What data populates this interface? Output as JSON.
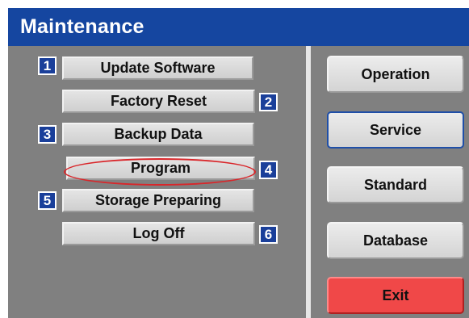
{
  "window": {
    "title": "Maintenance"
  },
  "menu": {
    "items": [
      {
        "number": "1",
        "label": "Update Software"
      },
      {
        "number": "2",
        "label": "Factory Reset"
      },
      {
        "number": "3",
        "label": "Backup Data"
      },
      {
        "number": "4",
        "label": "Program",
        "highlighted": true
      },
      {
        "number": "5",
        "label": "Storage Preparing"
      },
      {
        "number": "6",
        "label": "Log Off"
      }
    ]
  },
  "sidebar": {
    "buttons": [
      {
        "label": "Operation",
        "selected": false
      },
      {
        "label": "Service",
        "selected": true
      },
      {
        "label": "Standard",
        "selected": false
      },
      {
        "label": "Database",
        "selected": false
      },
      {
        "label": "Exit",
        "selected": false
      }
    ]
  },
  "colors": {
    "title_bar": "#1546a0",
    "panel": "#808080",
    "number_badge": "#1a3f9a",
    "highlight_oval": "#d9262a",
    "exit_button": "#f04848",
    "selected_border": "#1f4fa8"
  }
}
